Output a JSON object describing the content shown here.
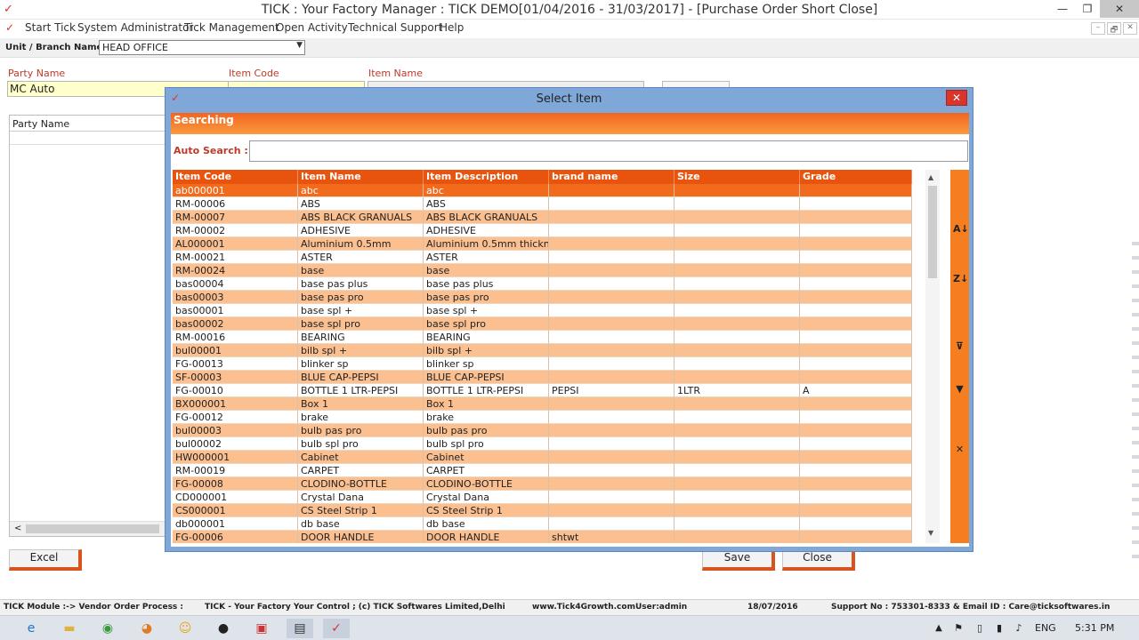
{
  "window": {
    "title": "TICK : Your Factory Manager : TICK DEMO[01/04/2016 - 31/03/2017] - [Purchase Order Short Close]",
    "minimize": "—",
    "restore": "❐",
    "close": "✕",
    "app_icon": "tick-logo-icon"
  },
  "menu": {
    "items": [
      "Start Tick",
      "System Administrator",
      "Tick Management",
      "Open Activity",
      "Technical Support",
      "Help"
    ],
    "mdi_controls": [
      "–",
      "🗗",
      "✕"
    ]
  },
  "unit": {
    "label": "Unit / Branch Name :",
    "value": "HEAD OFFICE"
  },
  "form": {
    "party_name_label": "Party Name",
    "party_name_value": "MC Auto",
    "item_code_label": "Item Code",
    "item_name_label": "Item Name",
    "grid_header": "Party Name",
    "excel_button": "Excel",
    "save_button": "Save",
    "close_button": "Close",
    "scroll_left": "<"
  },
  "dialog": {
    "title": "Select Item",
    "close": "✕",
    "section": "Searching",
    "auto_search_label": "Auto Search :",
    "auto_search_value": "",
    "columns": [
      "Item Code",
      "Item Name",
      "Item Description",
      "brand name",
      "Size",
      "Grade"
    ],
    "rows": [
      [
        "ab000001",
        "abc",
        "abc",
        "",
        "",
        ""
      ],
      [
        "RM-00006",
        "ABS",
        "ABS",
        "",
        "",
        ""
      ],
      [
        "RM-00007",
        "ABS BLACK GRANUALS",
        "ABS BLACK GRANUALS",
        "",
        "",
        ""
      ],
      [
        "RM-00002",
        "ADHESIVE",
        "ADHESIVE",
        "",
        "",
        ""
      ],
      [
        "AL000001",
        "Aluminium 0.5mm",
        "Aluminium 0.5mm thickn",
        "",
        "",
        ""
      ],
      [
        "RM-00021",
        "ASTER",
        "ASTER",
        "",
        "",
        ""
      ],
      [
        "RM-00024",
        "base",
        "base",
        "",
        "",
        ""
      ],
      [
        "bas00004",
        "base pas plus",
        "base pas plus",
        "",
        "",
        ""
      ],
      [
        "bas00003",
        "base pas pro",
        "base pas pro",
        "",
        "",
        ""
      ],
      [
        "bas00001",
        "base spl +",
        "base spl +",
        "",
        "",
        ""
      ],
      [
        "bas00002",
        "base spl pro",
        "base spl pro",
        "",
        "",
        ""
      ],
      [
        "RM-00016",
        "BEARING",
        "BEARING",
        "",
        "",
        ""
      ],
      [
        "bul00001",
        "bilb spl +",
        "bilb spl +",
        "",
        "",
        ""
      ],
      [
        "FG-00013",
        "blinker sp",
        "blinker sp",
        "",
        "",
        ""
      ],
      [
        "SF-00003",
        "BLUE CAP-PEPSI",
        "BLUE CAP-PEPSI",
        "",
        "",
        ""
      ],
      [
        "FG-00010",
        "BOTTLE 1 LTR-PEPSI",
        "BOTTLE 1 LTR-PEPSI",
        "PEPSI",
        "1LTR",
        "A"
      ],
      [
        "BX000001",
        "Box 1",
        "Box 1",
        "",
        "",
        ""
      ],
      [
        "FG-00012",
        "brake",
        "brake",
        "",
        "",
        ""
      ],
      [
        "bul00003",
        "bulb pas pro",
        "bulb pas pro",
        "",
        "",
        ""
      ],
      [
        "bul00002",
        "bulb spl pro",
        "bulb spl pro",
        "",
        "",
        ""
      ],
      [
        "HW000001",
        "Cabinet",
        "Cabinet",
        "",
        "",
        ""
      ],
      [
        "RM-00019",
        "CARPET",
        "CARPET",
        "",
        "",
        ""
      ],
      [
        "FG-00008",
        "CLODINO-BOTTLE",
        "CLODINO-BOTTLE",
        "",
        "",
        ""
      ],
      [
        "CD000001",
        "Crystal Dana",
        "Crystal Dana",
        "",
        "",
        ""
      ],
      [
        "CS000001",
        "CS Steel Strip 1",
        "CS Steel Strip 1",
        "",
        "",
        ""
      ],
      [
        "db000001",
        "db base",
        "db base",
        "",
        "",
        ""
      ],
      [
        "FG-00006",
        "DOOR HANDLE",
        "DOOR HANDLE",
        "shtwt",
        "",
        ""
      ]
    ],
    "side_tools": [
      "sort-asc-icon",
      "sort-desc-icon",
      "clear-filter-icon",
      "filter-icon",
      "remove-icon"
    ],
    "scroll_up": "▲",
    "scroll_down": "▼"
  },
  "status": {
    "module": "TICK Module :-> Vendor Order Process :",
    "company": "TICK - Your Factory Your Control ;  (c) TICK Softwares Limited,Delhi",
    "website": "www.Tick4Growth.com",
    "user": "User:admin",
    "date": "18/07/2016",
    "support": "Support No : 753301-8333 & Email ID : Care@ticksoftwares.in"
  },
  "taskbar": {
    "language": "ENG",
    "time": "5:31 PM"
  },
  "colors": {
    "accent": "#e8540d",
    "row_alt": "#fcbf8f",
    "row_selected": "#f26b1d",
    "dialog_frame": "#7fa8d8",
    "label_red": "#c0392b"
  }
}
